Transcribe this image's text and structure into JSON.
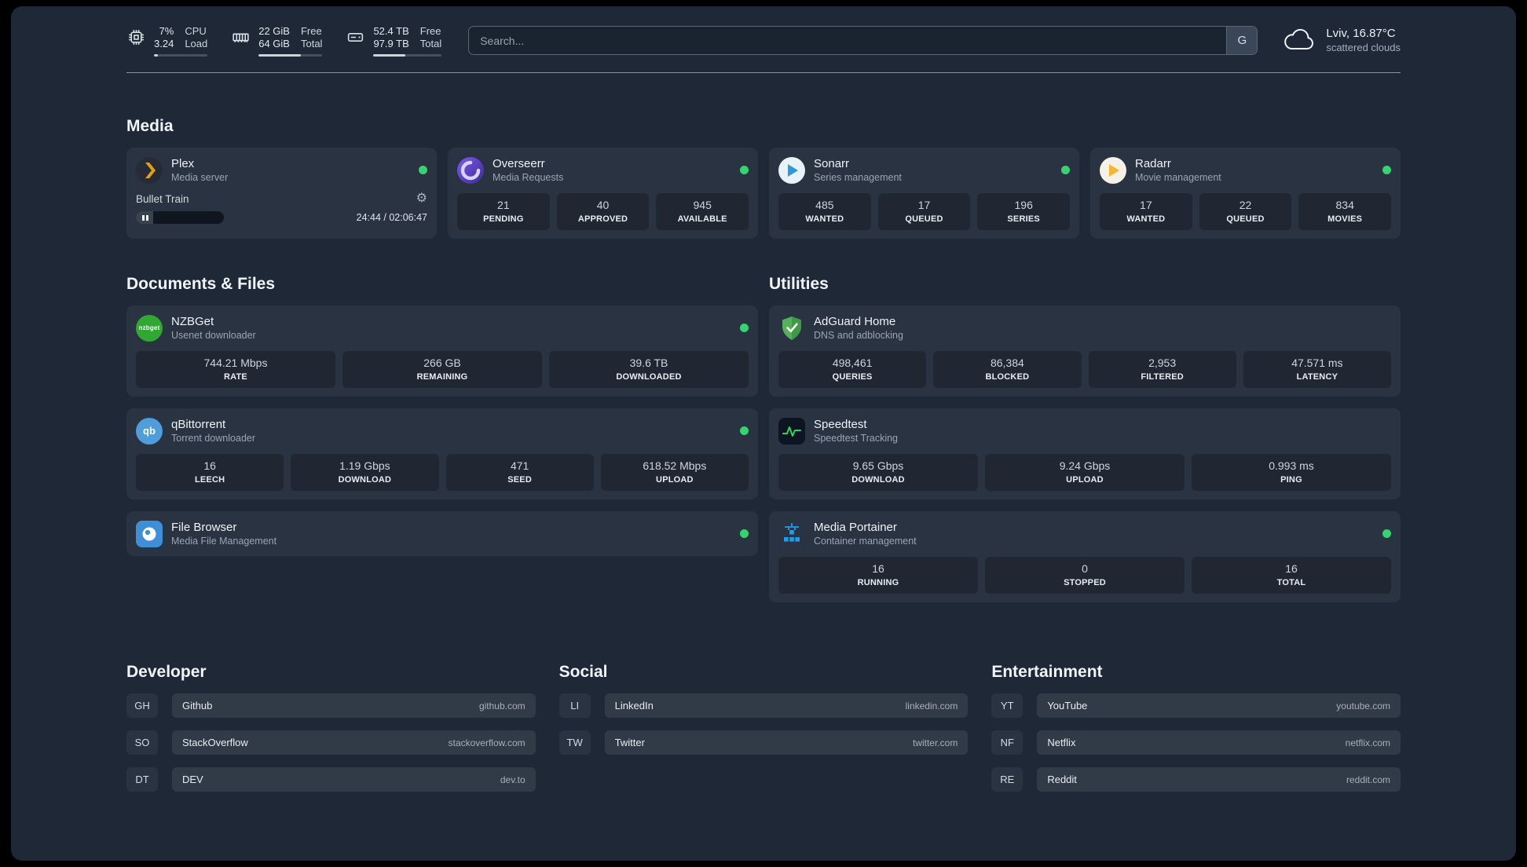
{
  "colors": {
    "status_online": "#34d46e",
    "accent_green": "#2fd35f",
    "portainer_blue": "#1f9ded",
    "plex_amber": "#e5a00d"
  },
  "topbar": {
    "cpu": {
      "usage": "7%",
      "load": "3.24",
      "label_top": "CPU",
      "label_bottom": "Load",
      "progress_pct": 7
    },
    "memory": {
      "free": "22 GiB",
      "total": "64 GiB",
      "label_top": "Free",
      "label_bottom": "Total",
      "progress_pct": 66
    },
    "disk": {
      "free": "52.4 TB",
      "total": "97.9 TB",
      "label_top": "Free",
      "label_bottom": "Total",
      "progress_pct": 47
    },
    "search": {
      "placeholder": "Search...",
      "provider_button": "G"
    },
    "weather": {
      "location": "Lviv, 16.87°C",
      "condition": "scattered clouds"
    }
  },
  "media": {
    "title": "Media",
    "plex": {
      "name": "Plex",
      "desc": "Media server",
      "now_playing": "Bullet Train",
      "time": "24:44 / 02:06:47",
      "progress_pct": 20
    },
    "overseerr": {
      "name": "Overseerr",
      "desc": "Media Requests",
      "stats": [
        {
          "value": "21",
          "label": "PENDING"
        },
        {
          "value": "40",
          "label": "APPROVED"
        },
        {
          "value": "945",
          "label": "AVAILABLE"
        }
      ]
    },
    "sonarr": {
      "name": "Sonarr",
      "desc": "Series management",
      "stats": [
        {
          "value": "485",
          "label": "WANTED"
        },
        {
          "value": "17",
          "label": "QUEUED"
        },
        {
          "value": "196",
          "label": "SERIES"
        }
      ]
    },
    "radarr": {
      "name": "Radarr",
      "desc": "Movie management",
      "stats": [
        {
          "value": "17",
          "label": "WANTED"
        },
        {
          "value": "22",
          "label": "QUEUED"
        },
        {
          "value": "834",
          "label": "MOVIES"
        }
      ]
    }
  },
  "documents": {
    "title": "Documents & Files",
    "nzbget": {
      "name": "NZBGet",
      "desc": "Usenet downloader",
      "stats": [
        {
          "value": "744.21 Mbps",
          "label": "RATE"
        },
        {
          "value": "266 GB",
          "label": "REMAINING"
        },
        {
          "value": "39.6 TB",
          "label": "DOWNLOADED"
        }
      ]
    },
    "qbittorrent": {
      "name": "qBittorrent",
      "desc": "Torrent downloader",
      "stats": [
        {
          "value": "16",
          "label": "LEECH"
        },
        {
          "value": "1.19 Gbps",
          "label": "DOWNLOAD"
        },
        {
          "value": "471",
          "label": "SEED"
        },
        {
          "value": "618.52 Mbps",
          "label": "UPLOAD"
        }
      ]
    },
    "filebrowser": {
      "name": "File Browser",
      "desc": "Media File Management"
    }
  },
  "utilities": {
    "title": "Utilities",
    "adguard": {
      "name": "AdGuard Home",
      "desc": "DNS and adblocking",
      "stats": [
        {
          "value": "498,461",
          "label": "QUERIES"
        },
        {
          "value": "86,384",
          "label": "BLOCKED"
        },
        {
          "value": "2,953",
          "label": "FILTERED"
        },
        {
          "value": "47.571 ms",
          "label": "LATENCY"
        }
      ]
    },
    "speedtest": {
      "name": "Speedtest",
      "desc": "Speedtest Tracking",
      "stats": [
        {
          "value": "9.65 Gbps",
          "label": "DOWNLOAD"
        },
        {
          "value": "9.24 Gbps",
          "label": "UPLOAD"
        },
        {
          "value": "0.993 ms",
          "label": "PING"
        }
      ]
    },
    "portainer": {
      "name": "Media Portainer",
      "desc": "Container management",
      "stats": [
        {
          "value": "16",
          "label": "RUNNING"
        },
        {
          "value": "0",
          "label": "STOPPED"
        },
        {
          "value": "16",
          "label": "TOTAL"
        }
      ]
    }
  },
  "bookmarks": [
    {
      "title": "Developer",
      "items": [
        {
          "abbr": "GH",
          "name": "Github",
          "domain": "github.com"
        },
        {
          "abbr": "SO",
          "name": "StackOverflow",
          "domain": "stackoverflow.com"
        },
        {
          "abbr": "DT",
          "name": "DEV",
          "domain": "dev.to"
        }
      ]
    },
    {
      "title": "Social",
      "items": [
        {
          "abbr": "LI",
          "name": "LinkedIn",
          "domain": "linkedin.com"
        },
        {
          "abbr": "TW",
          "name": "Twitter",
          "domain": "twitter.com"
        }
      ]
    },
    {
      "title": "Entertainment",
      "items": [
        {
          "abbr": "YT",
          "name": "YouTube",
          "domain": "youtube.com"
        },
        {
          "abbr": "NF",
          "name": "Netflix",
          "domain": "netflix.com"
        },
        {
          "abbr": "RE",
          "name": "Reddit",
          "domain": "reddit.com"
        }
      ]
    }
  ]
}
